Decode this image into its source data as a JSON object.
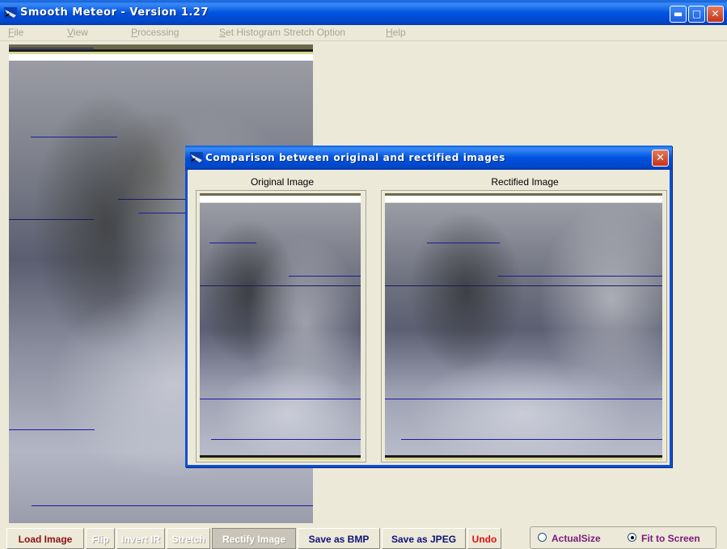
{
  "window": {
    "title": "Smooth Meteor - Version 1.27"
  },
  "menu": [
    {
      "label": "File",
      "mnemonic": "F"
    },
    {
      "label": "View",
      "mnemonic": "V"
    },
    {
      "label": "Processing",
      "mnemonic": "P"
    },
    {
      "label": "Set Histogram Stretch Option",
      "mnemonic": "S"
    },
    {
      "label": "Help",
      "mnemonic": "H"
    }
  ],
  "dialog": {
    "title": "Comparison between original and rectified images",
    "original_label": "Original Image",
    "rectified_label": "Rectified Image"
  },
  "toolbar": {
    "load_image": "Load Image",
    "flip": "Flip",
    "invert_ir": "Invert IR",
    "stretch": "Stretch",
    "rectify_image": "Rectify Image",
    "save_bmp": "Save as BMP",
    "save_jpeg": "Save as JPEG",
    "undo": "Undo"
  },
  "view_options": {
    "actual_size": "ActualSize",
    "fit_to_screen": "Fit to Screen",
    "selected": "Fit to Screen"
  },
  "colors": {
    "load_image": "#8b1010",
    "disabled": "#a7a597",
    "save": "#10107a",
    "undo": "#e01010",
    "radio_label": "#7a1a7a",
    "titlebar": "#0053e0"
  }
}
